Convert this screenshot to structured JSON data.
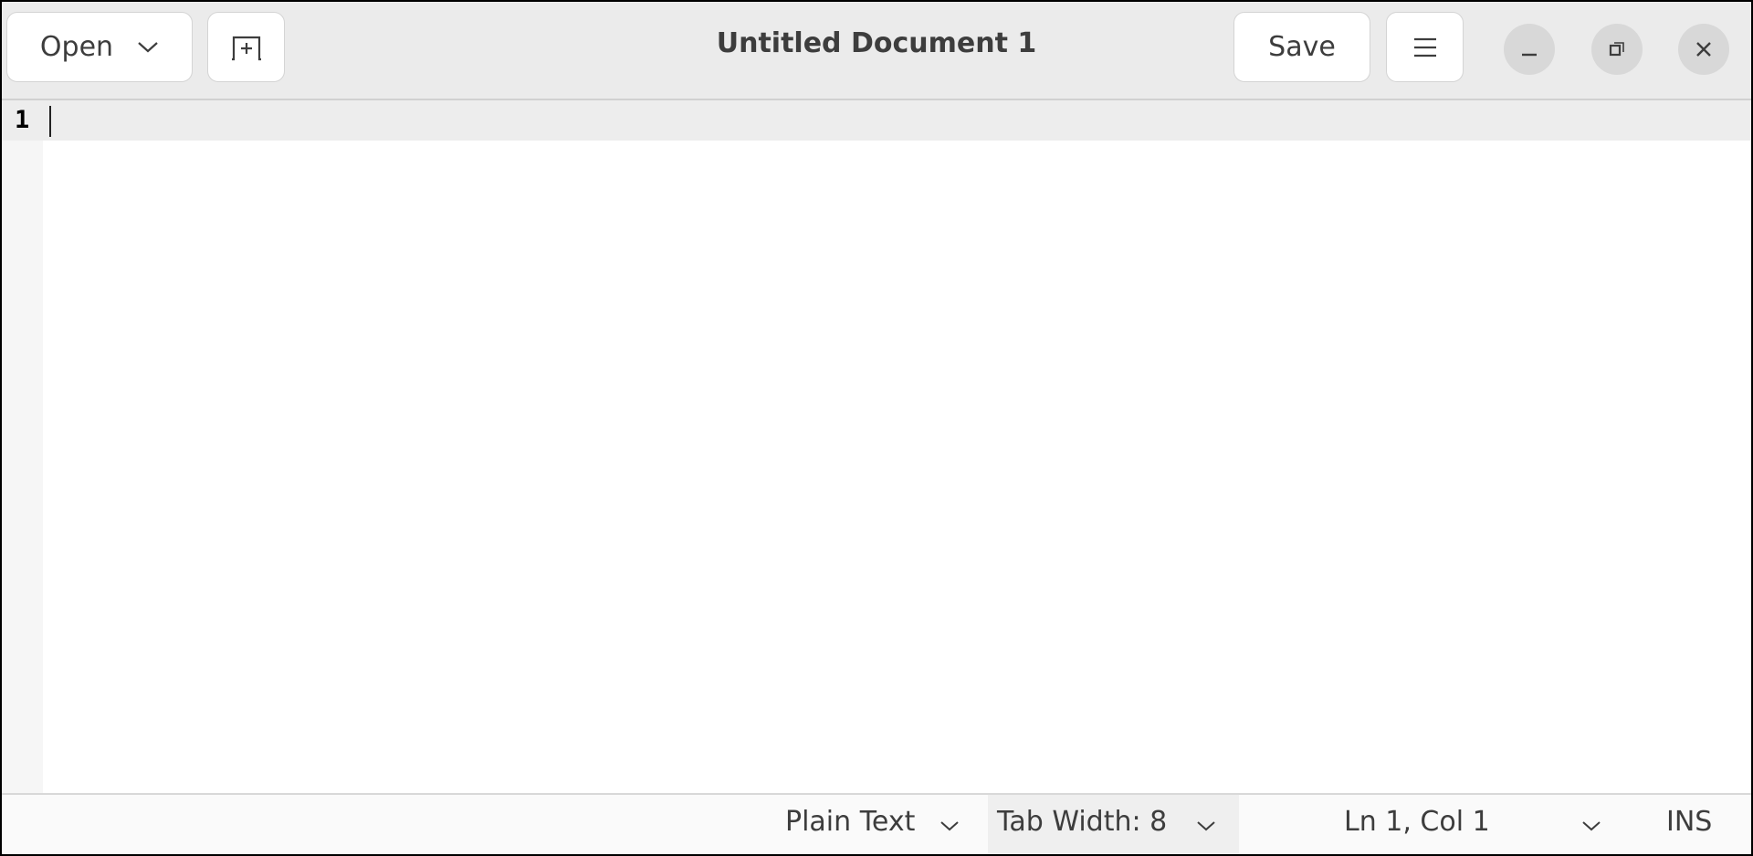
{
  "header": {
    "open_label": "Open",
    "title": "Untitled Document 1",
    "save_label": "Save",
    "icons": [
      "chevron-down-icon",
      "new-tab-icon",
      "hamburger-menu-icon",
      "minimize-icon",
      "restore-icon",
      "close-icon"
    ]
  },
  "editor": {
    "line_numbers": [
      "1"
    ],
    "content": ""
  },
  "statusbar": {
    "language": "Plain Text",
    "tab_width": "Tab Width: 8",
    "position": "Ln 1, Col 1",
    "mode": "INS"
  }
}
